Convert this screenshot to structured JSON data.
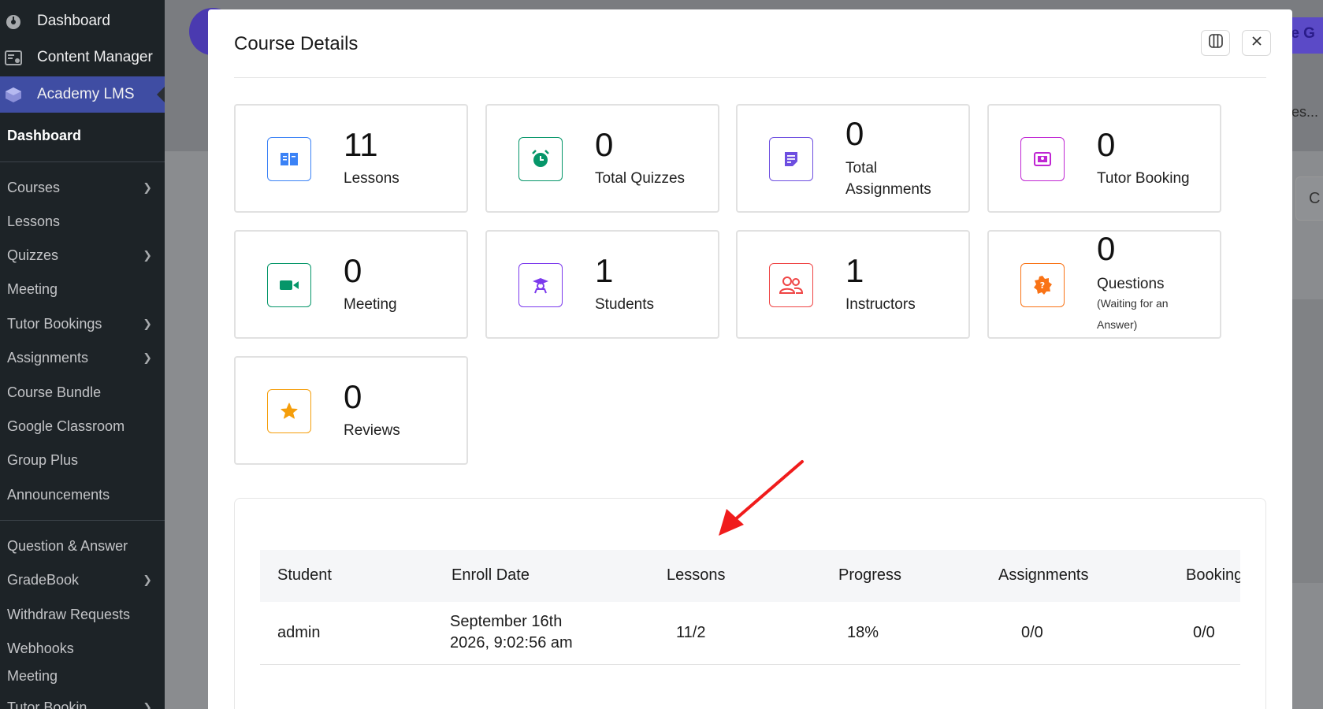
{
  "sidebar": {
    "top_items": [
      {
        "label": "Dashboard",
        "icon": "dashboard-icon"
      },
      {
        "label": "Content Manager",
        "icon": "content-manager-icon"
      },
      {
        "label": "Academy LMS",
        "icon": "academy-lms-icon"
      }
    ],
    "sub_items": [
      {
        "label": "Dashboard",
        "has_submenu": false
      },
      {
        "label": "Courses",
        "has_submenu": true
      },
      {
        "label": "Lessons",
        "has_submenu": false
      },
      {
        "label": "Quizzes",
        "has_submenu": true
      },
      {
        "label": "Meeting",
        "has_submenu": false
      },
      {
        "label": "Tutor Bookings",
        "has_submenu": true
      },
      {
        "label": "Assignments",
        "has_submenu": true
      },
      {
        "label": "Course Bundle",
        "has_submenu": false
      },
      {
        "label": "Google Classroom",
        "has_submenu": false
      },
      {
        "label": "Group Plus",
        "has_submenu": false
      },
      {
        "label": "Announcements",
        "has_submenu": false
      },
      {
        "label": "Question & Answer",
        "has_submenu": false
      },
      {
        "label": "GradeBook",
        "has_submenu": true
      },
      {
        "label": "Withdraw Requests",
        "has_submenu": false
      },
      {
        "label": "Webhooks",
        "has_submenu": false
      },
      {
        "label": "Meeting",
        "has_submenu": false
      },
      {
        "label": "Tutor Bookin...",
        "has_submenu": true
      }
    ]
  },
  "background": {
    "right_button_text": "te G",
    "right_text": "ges...",
    "right_small_button": "C"
  },
  "modal": {
    "title": "Course Details",
    "stats": [
      {
        "value": "11",
        "label": "Lessons",
        "icon": "book-icon",
        "color": "#3b82f6"
      },
      {
        "value": "0",
        "label": "Total Quizzes",
        "icon": "alarm-clock-icon",
        "color": "#059669"
      },
      {
        "value": "0",
        "label": "Total Assignments",
        "icon": "assignment-note-icon",
        "color": "#6d4ee0"
      },
      {
        "value": "0",
        "label": "Tutor Booking",
        "icon": "booking-card-icon",
        "color": "#c026d3"
      },
      {
        "value": "0",
        "label": "Meeting",
        "icon": "video-camera-icon",
        "color": "#059669"
      },
      {
        "value": "1",
        "label": "Students",
        "icon": "student-graduate-icon",
        "color": "#7c3aed"
      },
      {
        "value": "1",
        "label": "Instructors",
        "icon": "instructors-people-icon",
        "color": "#ef4444"
      },
      {
        "value": "0",
        "label": "Questions",
        "sublabel": "(Waiting for an Answer)",
        "icon": "question-badge-icon",
        "color": "#f97316"
      },
      {
        "value": "0",
        "label": "Reviews",
        "icon": "star-icon",
        "color": "#f59e0b"
      }
    ],
    "table": {
      "columns": [
        "Student",
        "Enroll Date",
        "Lessons",
        "Progress",
        "Assignments",
        "Booking"
      ],
      "rows": [
        {
          "student": "admin",
          "enroll_date_line1": "September 16th",
          "enroll_date_line2": "2026, 9:02:56 am",
          "lessons": "11/2",
          "progress": "18%",
          "assignments": "0/0",
          "booking": "0/0"
        }
      ]
    }
  },
  "colors": {
    "sidebar_bg": "#1d2327",
    "active_menu_bg": "#3f4da3",
    "annotation_arrow": "#f01c1c"
  }
}
